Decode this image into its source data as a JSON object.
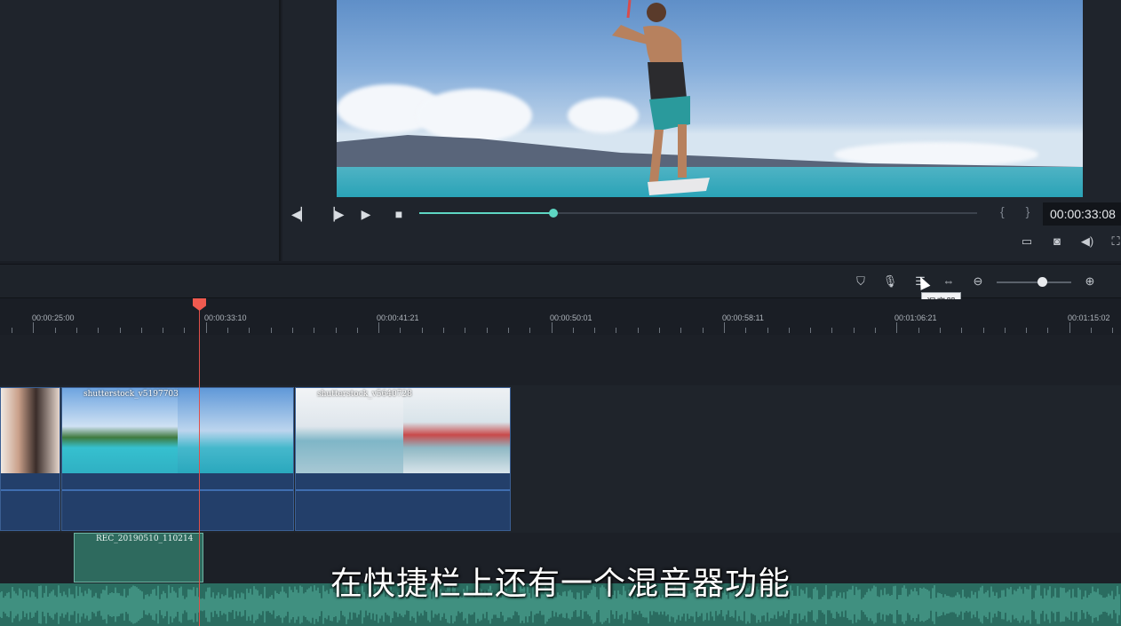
{
  "preview": {
    "timecode": "00:00:33:08",
    "progress": 0.24,
    "brackets": "{ }",
    "controls": [
      "prev-frame",
      "play-slow",
      "play",
      "stop"
    ]
  },
  "toolbar": {
    "tooltip": "混音器",
    "zoom_level": 0.6
  },
  "ruler": {
    "labels": [
      "00:00:25:00",
      "00:00:33:10",
      "00:00:41:21",
      "00:00:50:01",
      "00:00:58:11",
      "00:01:06:21",
      "00:01:15:02"
    ]
  },
  "timeline": {
    "video_clips": [
      {
        "name": ""
      },
      {
        "name": "shutterstock_v5197703"
      },
      {
        "name": "shutterstock_v5640728"
      }
    ],
    "audio_clip": {
      "name": "REC_20190510_110214"
    }
  },
  "subtitle": "在快捷栏上还有一个混音器功能",
  "colors": {
    "accent": "#5ed6c3",
    "playhead": "#ef5a4f",
    "clip": "#233f6a",
    "audio": "#2a6c60"
  }
}
